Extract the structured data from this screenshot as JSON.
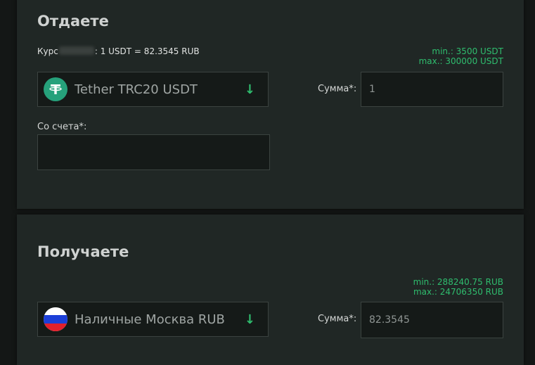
{
  "give": {
    "title": "Отдаете",
    "rate_prefix": "Курс",
    "rate_suffix": ": 1 USDT = 82.3545 RUB",
    "min": "min.: 3500 USDT",
    "max": "max.: 300000 USDT",
    "currency": "Tether TRC20 USDT",
    "currency_icon": "tether-icon",
    "sum_label": "Сумма*:",
    "sum_value": "1",
    "account_label": "Со счета*:",
    "account_value": ""
  },
  "receive": {
    "title": "Получаете",
    "min": "min.: 288240.75 RUB",
    "max": "max.: 24706350 RUB",
    "currency": "Наличные Москва RUB",
    "currency_icon": "russia-flag-icon",
    "sum_label": "Сумма*:",
    "sum_value": "82.3545"
  },
  "colors": {
    "accent": "#2fbd6e",
    "panel": "#202725",
    "input_bg": "#151a18",
    "tether": "#26a17b"
  },
  "icons": {
    "dropdown": "↓"
  }
}
